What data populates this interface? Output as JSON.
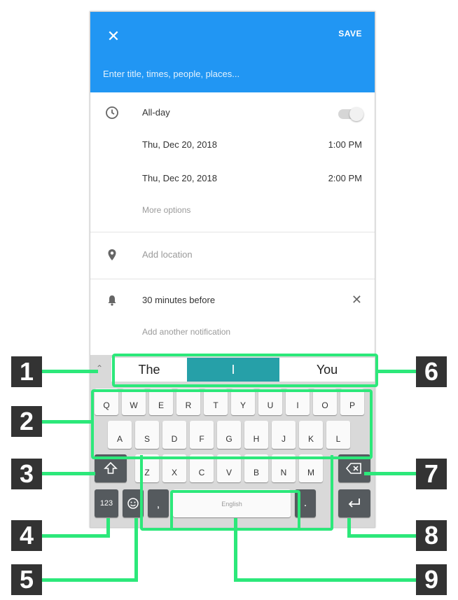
{
  "appbar": {
    "save_label": "SAVE",
    "title_placeholder": "Enter title, times, people, places..."
  },
  "event": {
    "all_day_label": "All-day",
    "start_date": "Thu, Dec 20, 2018",
    "start_time": "1:00 PM",
    "end_date": "Thu, Dec 20, 2018",
    "end_time": "2:00 PM",
    "more_options": "More options",
    "add_location": "Add location",
    "notification": "30 minutes before",
    "add_notification": "Add another notification"
  },
  "keyboard": {
    "suggestions": [
      "The",
      "I",
      "You"
    ],
    "row1": [
      "Q",
      "W",
      "E",
      "R",
      "T",
      "Y",
      "U",
      "I",
      "O",
      "P"
    ],
    "row2": [
      "A",
      "S",
      "D",
      "F",
      "G",
      "H",
      "J",
      "K",
      "L"
    ],
    "row3": [
      "Z",
      "X",
      "C",
      "V",
      "B",
      "N",
      "M"
    ],
    "numbers_key": "123",
    "comma_key": ",",
    "space_hint": "English",
    "period_key": "."
  },
  "callouts": [
    "1",
    "2",
    "3",
    "4",
    "5",
    "6",
    "7",
    "8",
    "9"
  ],
  "colors": {
    "appbar": "#2196f3",
    "suggestion_highlight": "#26a0a8",
    "callout_line": "#2ce87a"
  }
}
